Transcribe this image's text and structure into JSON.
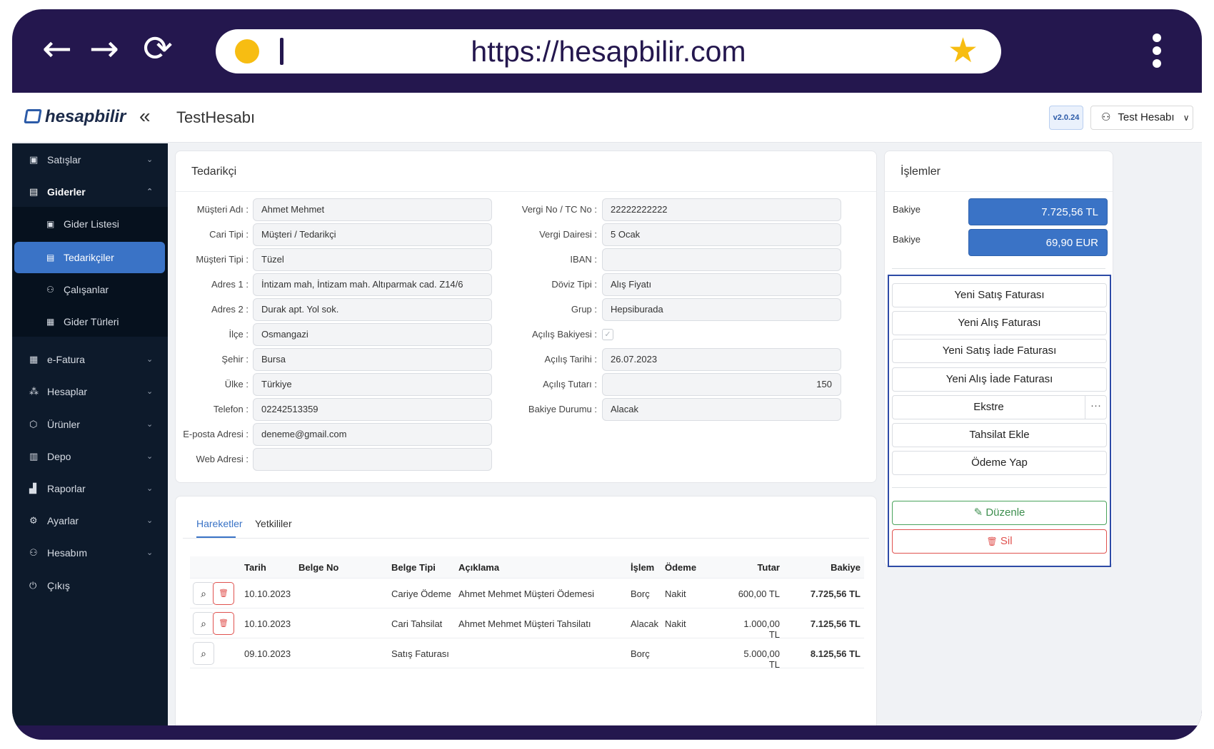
{
  "browser": {
    "url": "https://hesapbilir.com",
    "back_icon": "←",
    "forward_icon": "→",
    "reload_icon": "⟳",
    "star_icon": "★"
  },
  "app": {
    "logo": "hesapbilir",
    "collapse_icon": "«",
    "title": "TestHesabı",
    "version": "v2.0.24",
    "user": "Test Hesabı",
    "user_icon": "⚇",
    "user_chevron": "∨"
  },
  "sidebar": {
    "items": [
      {
        "label": "Satışlar",
        "icon": "▣"
      },
      {
        "label": "Giderler",
        "icon": "▤"
      },
      {
        "label": "e-Fatura",
        "icon": "▦"
      },
      {
        "label": "Hesaplar",
        "icon": "⁂"
      },
      {
        "label": "Ürünler",
        "icon": "⬡"
      },
      {
        "label": "Depo",
        "icon": "▥"
      },
      {
        "label": "Raporlar",
        "icon": "▟"
      },
      {
        "label": "Ayarlar",
        "icon": "⚙"
      },
      {
        "label": "Hesabım",
        "icon": "⚇"
      },
      {
        "label": "Çıkış",
        "icon": "⏻"
      }
    ],
    "sub_items": [
      {
        "label": "Gider Listesi",
        "icon": "▣"
      },
      {
        "label": "Tedarikçiler",
        "icon": "▤"
      },
      {
        "label": "Çalışanlar",
        "icon": "⚇"
      },
      {
        "label": "Gider Türleri",
        "icon": "▦"
      }
    ],
    "chevron_down": "⌄",
    "chevron_up": "⌃"
  },
  "supplier_card": {
    "title": "Tedarikçi",
    "left_fields": [
      {
        "label": "Müşteri Adı :",
        "value": "Ahmet Mehmet"
      },
      {
        "label": "Cari Tipi :",
        "value": "Müşteri / Tedarikçi"
      },
      {
        "label": "Müşteri Tipi :",
        "value": "Tüzel"
      },
      {
        "label": "Adres 1 :",
        "value": "İntizam mah, İntizam mah. Altıparmak cad. Z14/6"
      },
      {
        "label": "Adres 2 :",
        "value": "Durak apt. Yol sok."
      },
      {
        "label": "İlçe :",
        "value": "Osmangazi"
      },
      {
        "label": "Şehir :",
        "value": "Bursa"
      },
      {
        "label": "Ülke :",
        "value": "Türkiye"
      },
      {
        "label": "Telefon :",
        "value": "02242513359"
      },
      {
        "label": "E-posta Adresi :",
        "value": "deneme@gmail.com"
      },
      {
        "label": "Web Adresi :",
        "value": ""
      }
    ],
    "right_fields": [
      {
        "label": "Vergi No / TC No :",
        "value": "22222222222"
      },
      {
        "label": "Vergi Dairesi :",
        "value": "5 Ocak"
      },
      {
        "label": "IBAN :",
        "value": ""
      },
      {
        "label": "Döviz Tipi :",
        "value": "Alış Fiyatı"
      },
      {
        "label": "Grup :",
        "value": "Hepsiburada"
      },
      {
        "label": "Açılış Bakiyesi :",
        "value": "✓"
      },
      {
        "label": "Açılış Tarihi :",
        "value": "26.07.2023"
      },
      {
        "label": "Açılış Tutarı :",
        "value": "150"
      },
      {
        "label": "Bakiye Durumu :",
        "value": "Alacak"
      }
    ]
  },
  "actions_card": {
    "title": "İşlemler",
    "balances": [
      {
        "label": "Bakiye",
        "value": "7.725,56 TL"
      },
      {
        "label": "Bakiye",
        "value": "69,90 EUR"
      }
    ],
    "buttons": [
      "Yeni Satış Faturası",
      "Yeni Alış Faturası",
      "Yeni Satış İade Faturası",
      "Yeni Alış İade Faturası",
      "Ekstre",
      "Tahsilat Ekle",
      "Ödeme Yap"
    ],
    "more_icon": "···",
    "edit_label": "Düzenle",
    "edit_icon": "✎",
    "delete_label": "Sil",
    "delete_icon": "🗑"
  },
  "movements": {
    "tabs": [
      "Hareketler",
      "Yetkililer"
    ],
    "columns": [
      "Tarih",
      "Belge No",
      "Belge Tipi",
      "Açıklama",
      "İşlem",
      "Ödeme",
      "Tutar",
      "Bakiye"
    ],
    "search_icon": "⌕",
    "delete_icon": "🗑",
    "rows": [
      {
        "date": "10.10.2023",
        "doc_no": "",
        "doc_type": "Cariye Ödeme",
        "desc": "Ahmet Mehmet Müşteri Ödemesi",
        "op": "Borç",
        "payment": "Nakit",
        "amount": "600,00 TL",
        "balance": "7.725,56 TL"
      },
      {
        "date": "10.10.2023",
        "doc_no": "",
        "doc_type": "Cari Tahsilat",
        "desc": "Ahmet Mehmet Müşteri Tahsilatı",
        "op": "Alacak",
        "payment": "Nakit",
        "amount": "1.000,00 TL",
        "balance": "7.125,56 TL"
      },
      {
        "date": "09.10.2023",
        "doc_no": "",
        "doc_type": "Satış Faturası",
        "desc": "",
        "op": "Borç",
        "payment": "",
        "amount": "5.000,00 TL",
        "balance": "8.125,56 TL"
      }
    ]
  }
}
